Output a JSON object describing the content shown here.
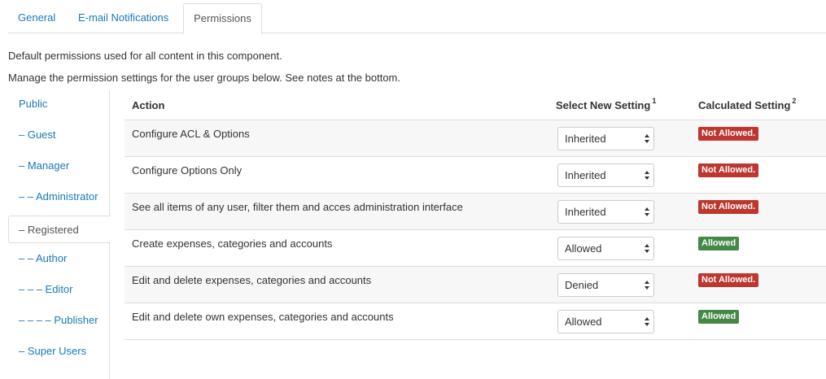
{
  "tabs": [
    "General",
    "E-mail Notifications",
    "Permissions"
  ],
  "active_tab": 2,
  "descriptions": [
    "Default permissions used for all content in this component.",
    "Manage the permission settings for the user groups below. See notes at the bottom."
  ],
  "groups": [
    "Public",
    "– Guest",
    "– Manager",
    "– – Administrator",
    "– Registered",
    "– – Author",
    "– – – Editor",
    "– – – – Publisher",
    "– Super Users"
  ],
  "active_group": 4,
  "table": {
    "headers": {
      "action": "Action",
      "select": "Select New Setting",
      "select_note": "1",
      "calculated": "Calculated Setting",
      "calculated_note": "2"
    },
    "rows": [
      {
        "action": "Configure ACL & Options",
        "setting": "Inherited",
        "calculated": "Not Allowed.",
        "status": "denied"
      },
      {
        "action": "Configure Options Only",
        "setting": "Inherited",
        "calculated": "Not Allowed.",
        "status": "denied"
      },
      {
        "action": "See all items of any user, filter them and acces administration interface",
        "setting": "Inherited",
        "calculated": "Not Allowed.",
        "status": "denied"
      },
      {
        "action": "Create expenses, categories and accounts",
        "setting": "Allowed",
        "calculated": "Allowed",
        "status": "allowed"
      },
      {
        "action": "Edit and delete expenses, categories and accounts",
        "setting": "Denied",
        "calculated": "Not Allowed.",
        "status": "denied"
      },
      {
        "action": "Edit and delete own expenses, categories and accounts",
        "setting": "Allowed",
        "calculated": "Allowed",
        "status": "allowed"
      }
    ]
  },
  "colors": {
    "link": "#1a78b8",
    "denied_badge": "#bd362f",
    "allowed_badge": "#468847"
  }
}
